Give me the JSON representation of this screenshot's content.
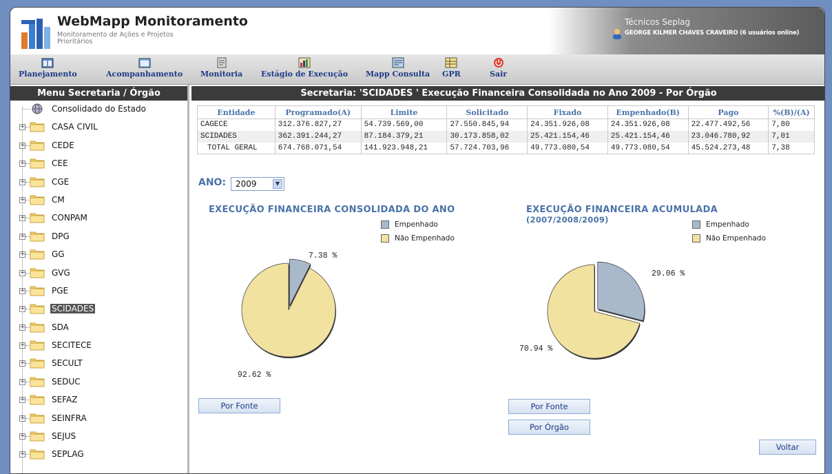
{
  "header": {
    "title": "WebMapp Monitoramento",
    "subtitle": "Monitoramento de Ações e Projetos Prioritários",
    "user_title": "Técnicos Seplag",
    "user_name": "GEORGE KILMER CHAVES CRAVEIRO (6 usuários online)"
  },
  "toolbar": {
    "items": [
      {
        "label": "Planejamento",
        "icon": "calendar-icon"
      },
      {
        "label": "Acompanhamento",
        "icon": "calendar-icon"
      },
      {
        "label": "Monitoria",
        "icon": "document-icon"
      },
      {
        "label": "Estágio de Execução",
        "icon": "chart-icon"
      },
      {
        "label": "Mapp Consulta",
        "icon": "report-icon"
      },
      {
        "label": "GPR",
        "icon": "table-icon"
      },
      {
        "label": "Sair",
        "icon": "power-icon"
      }
    ]
  },
  "sidebar": {
    "title": "Menu Secretaria / Órgão",
    "root": "Consolidado do Estado",
    "items": [
      "CASA CIVIL",
      "CEDE",
      "CEE",
      "CGE",
      "CM",
      "CONPAM",
      "DPG",
      "GG",
      "GVG",
      "PGE",
      "SCIDADES",
      "SDA",
      "SECITECE",
      "SECULT",
      "SEDUC",
      "SEFAZ",
      "SEINFRA",
      "SEJUS",
      "SEPLAG"
    ],
    "selected": "SCIDADES"
  },
  "main": {
    "title": "Secretaria: 'SCIDADES ' Execução Financeira Consolidada no Ano 2009 - Por Órgão",
    "table": {
      "headers": [
        "Entidade",
        "Programado(A)",
        "Limite",
        "Solicitado",
        "Fixado",
        "Empenhado(B)",
        "Pago",
        "%(B)/(A)"
      ],
      "rows": [
        [
          "CAGECE",
          "312.376.827,27",
          "54.739.569,00",
          "27.550.845,94",
          "24.351.926,08",
          "24.351.926,08",
          "22.477.492,56",
          "7,80"
        ],
        [
          "SCIDADES",
          "362.391.244,27",
          "87.184.379,21",
          "30.173.858,02",
          "25.421.154,46",
          "25.421.154,46",
          "23.046.780,92",
          "7,01"
        ],
        [
          "TOTAL GERAL",
          "674.768.071,54",
          "141.923.948,21",
          "57.724.703,96",
          "49.773.080,54",
          "49.773.080,54",
          "45.524.273,48",
          "7,38"
        ]
      ]
    },
    "ano_label": "ANO:",
    "ano_value": "2009",
    "chart1": {
      "title": "EXECUÇÃO FINANCEIRA CONSOLIDADA DO ANO",
      "legend": [
        "Empenhado",
        "Não Empenhado"
      ],
      "pct_empenhado": "7.38 %",
      "pct_nao": "92.62 %"
    },
    "chart2": {
      "title_line1": "EXECUÇÃO FINANCEIRA ACUMULADA",
      "title_line2": "(2007/2008/2009)",
      "legend": [
        "Empenhado",
        "Não Empenhado"
      ],
      "pct_empenhado": "29.06 %",
      "pct_nao": "70.94 %"
    },
    "buttons": {
      "por_fonte_1": "Por Fonte",
      "por_fonte_2": "Por Fonte",
      "por_orgao": "Por Órgão",
      "voltar": "Voltar"
    }
  },
  "colors": {
    "empenhado": "#a9b9cc",
    "nao_empenhado": "#f2e2a0",
    "accent": "#4a73a8"
  },
  "chart_data": [
    {
      "type": "pie",
      "title": "EXECUÇÃO FINANCEIRA CONSOLIDADA DO ANO",
      "labels": [
        "Empenhado",
        "Não Empenhado"
      ],
      "values": [
        7.38,
        92.62
      ]
    },
    {
      "type": "pie",
      "title": "EXECUÇÃO FINANCEIRA ACUMULADA (2007/2008/2009)",
      "labels": [
        "Empenhado",
        "Não Empenhado"
      ],
      "values": [
        29.06,
        70.94
      ]
    }
  ]
}
